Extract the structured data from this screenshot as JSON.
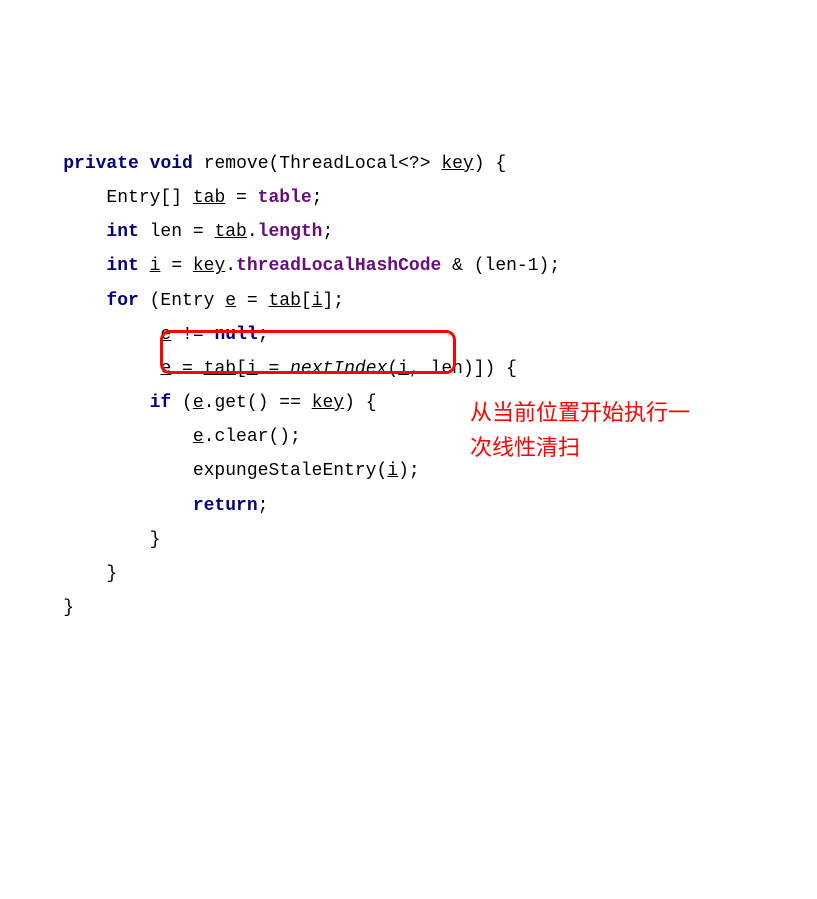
{
  "code": {
    "l1_kw1": "private",
    "l1_kw2": "void",
    "l1_method": "remove",
    "l1_paren1": "(ThreadLocal<?> ",
    "l1_param": "key",
    "l1_paren2": ") {",
    "l2_type": "Entry[] ",
    "l2_var": "tab",
    "l2_eq": " = ",
    "l2_field": "table",
    "l2_end": ";",
    "l3_kw": "int",
    "l3_var": " len = ",
    "l3_tab": "tab",
    "l3_dot": ".",
    "l3_field": "length",
    "l3_end": ";",
    "l4_kw": "int",
    "l4_i": "i",
    "l4_eq": " = ",
    "l4_key": "key",
    "l4_dot": ".",
    "l4_field": "threadLocalHashCode",
    "l4_rest": " & (len-1);",
    "l5_kw": "for",
    "l5_p1": " (Entry ",
    "l5_e": "e",
    "l5_eq": " = ",
    "l5_tab": "tab",
    "l5_br1": "[",
    "l5_i": "i",
    "l5_br2": "];",
    "l6_e": "e",
    "l6_rest": " != ",
    "l6_kw": "null",
    "l6_end": ";",
    "l7_e": "e",
    "l7_eq": " = ",
    "l7_tab": "tab",
    "l7_br1": "[",
    "l7_i": "i",
    "l7_eq2": " = ",
    "l7_fn": "nextIndex",
    "l7_p1": "(",
    "l7_i2": "i",
    "l7_rest": ", len)]) {",
    "l8_kw": "if",
    "l8_p1": " (",
    "l8_e": "e",
    "l8_call": ".get() == ",
    "l8_key": "key",
    "l8_p2": ") {",
    "l9_e": "e",
    "l9_rest": ".clear();",
    "l10_fn": "expungeStaleEntry(",
    "l10_i": "i",
    "l10_end": ");",
    "l11_kw": "return",
    "l11_end": ";",
    "l12": "}",
    "l13": "}",
    "l14": "}"
  },
  "annotation": "从当前位置开始执行一次线性清扫"
}
